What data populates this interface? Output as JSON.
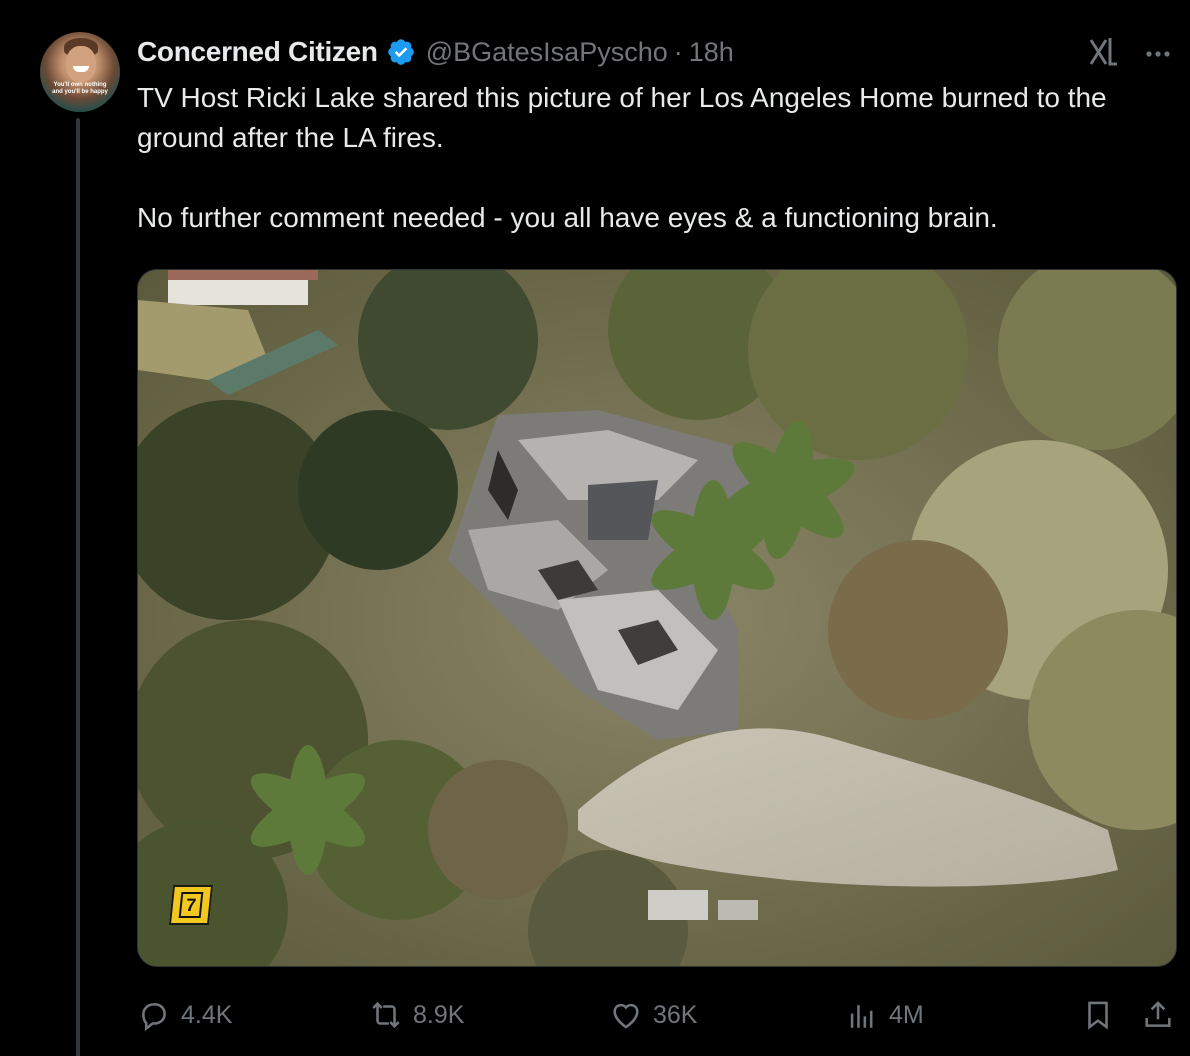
{
  "author": {
    "display_name": "Concerned Citizen",
    "handle": "@BGatesIsaPyscho",
    "time": "18h",
    "verified": true,
    "avatar_caption_line1": "You'll own nothing",
    "avatar_caption_line2": "and you'll be happy"
  },
  "tweet": {
    "text_line1": "TV Host Ricki Lake shared this picture of her Los Angeles Home burned to the ground after the LA fires.",
    "text_line2": "No further comment needed - you all have eyes & a functioning brain."
  },
  "media": {
    "badge_text": "7"
  },
  "actions": {
    "replies": "4.4K",
    "reposts": "8.9K",
    "likes": "36K",
    "views": "4M"
  },
  "colors": {
    "background": "#000000",
    "text": "#e7e9ea",
    "muted": "#71767b",
    "verified_blue": "#1d9bf0",
    "badge_yellow": "#f2c81e"
  },
  "icons": [
    "grok-icon",
    "more-icon",
    "verified-icon",
    "reply-icon",
    "repost-icon",
    "like-icon",
    "views-icon",
    "bookmark-icon",
    "share-icon"
  ]
}
